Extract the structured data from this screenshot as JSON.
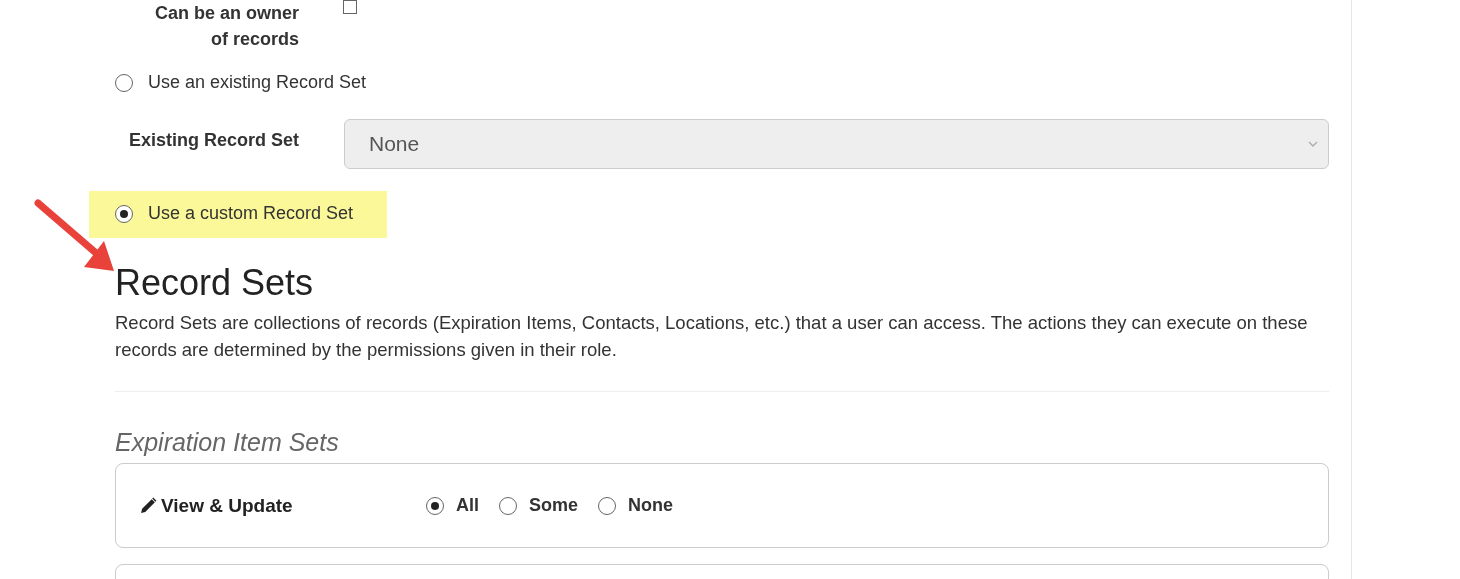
{
  "owner_option": {
    "label": "Can be an owner of records",
    "checked": false
  },
  "record_set_choice": [
    {
      "label": "Use an existing Record Set",
      "selected": false,
      "highlighted": false
    },
    {
      "label": "Use a custom Record Set",
      "selected": true,
      "highlighted": true
    }
  ],
  "existing_record_set": {
    "label": "Existing Record Set",
    "value": "None",
    "disabled": true
  },
  "record_sets": {
    "title": "Record Sets",
    "description": "Record Sets are collections of records (Expiration Items, Contacts, Locations, etc.) that a user can access. The actions they can execute on these records are determined by the permissions given in their role."
  },
  "expiration_item_sets": {
    "title": "Expiration Item Sets",
    "permissions": [
      {
        "label": "View & Update",
        "options": [
          {
            "label": "All",
            "selected": true
          },
          {
            "label": "Some",
            "selected": false
          },
          {
            "label": "None",
            "selected": false
          }
        ]
      }
    ]
  }
}
